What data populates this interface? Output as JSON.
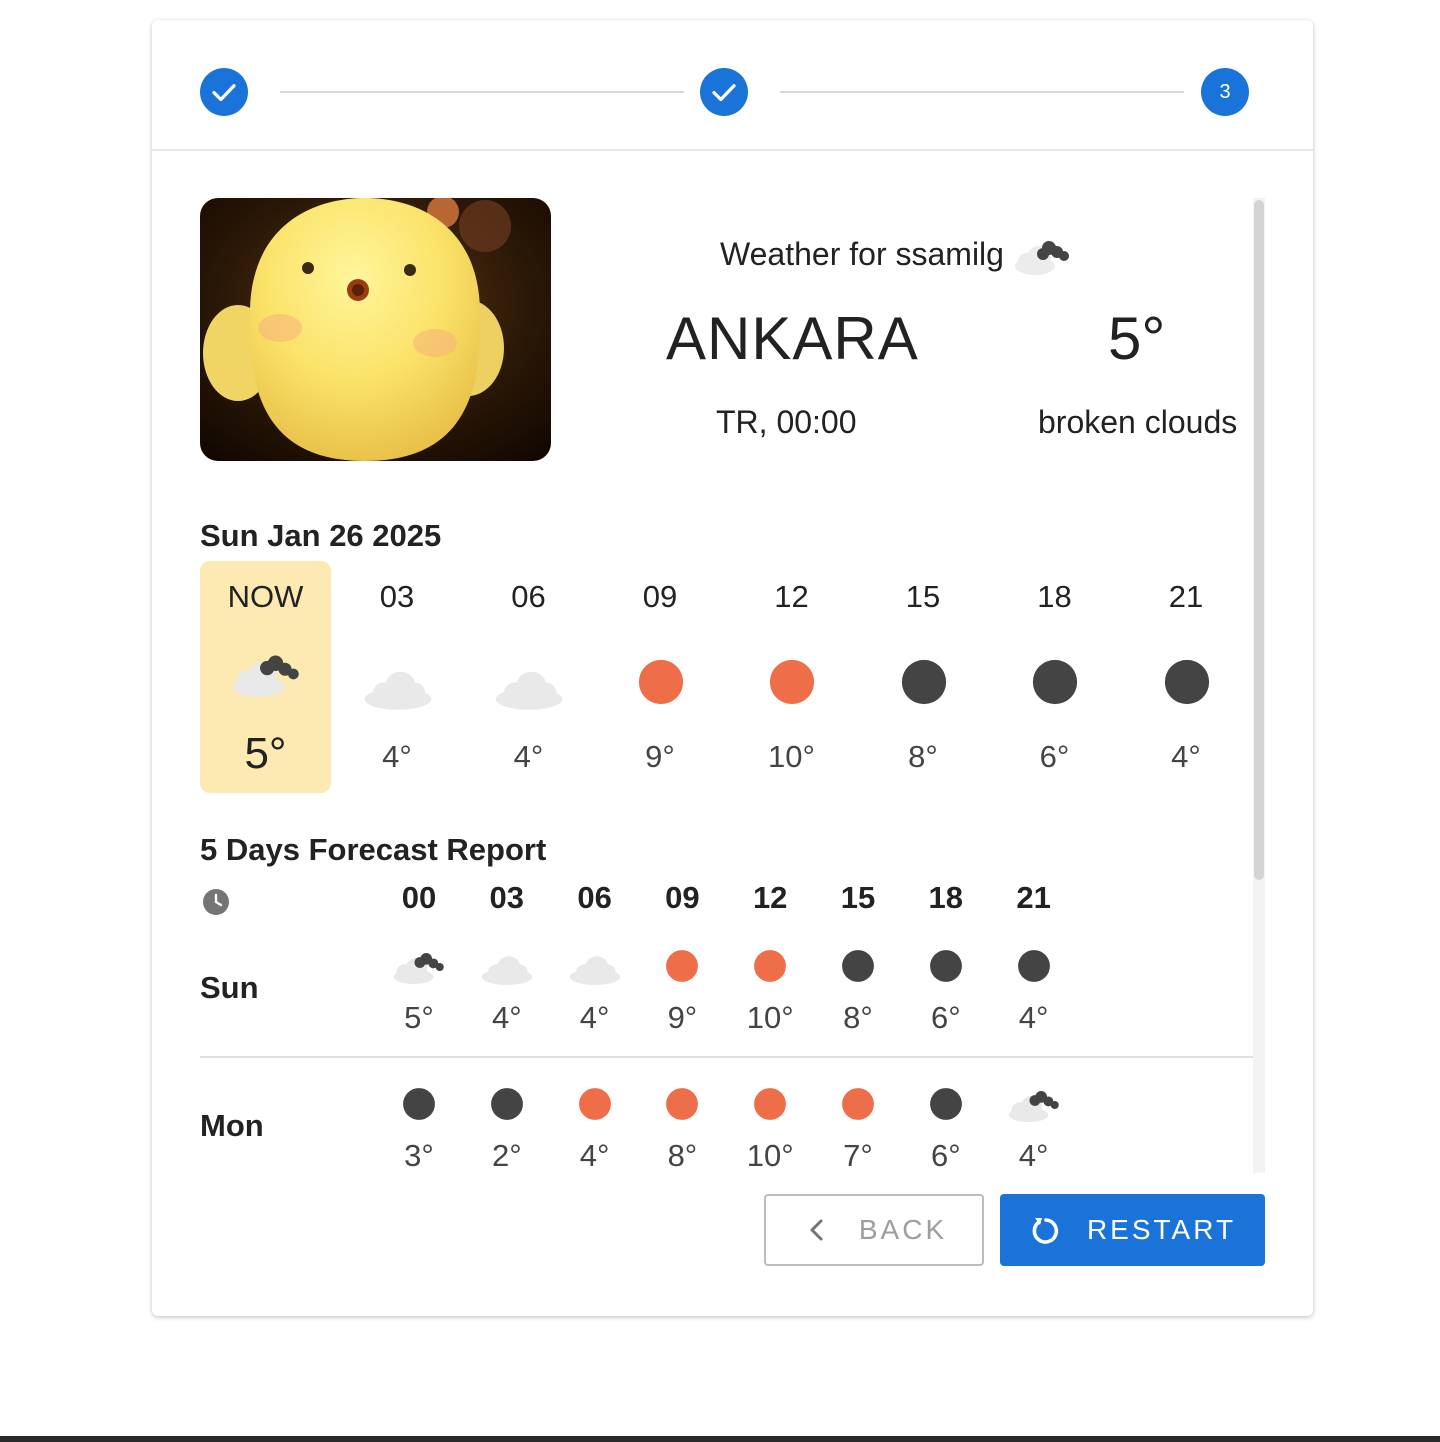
{
  "stepper": {
    "steps": [
      {
        "state": "completed",
        "icon": "check-icon"
      },
      {
        "state": "completed",
        "icon": "check-icon"
      },
      {
        "state": "active",
        "number": "3"
      }
    ],
    "accent": "#1a73d9"
  },
  "header": {
    "weather_for": "Weather for ssamilg",
    "header_icon": "broken-clouds-icon",
    "city": "ANKARA",
    "country_time": "TR, 00:00",
    "temperature": "5°",
    "description": "broken clouds"
  },
  "today": {
    "date": "Sun Jan 26 2025",
    "hours": [
      {
        "label": "NOW",
        "icon": "broken-clouds",
        "temp": "5°"
      },
      {
        "label": "03",
        "icon": "cloud",
        "temp": "4°"
      },
      {
        "label": "06",
        "icon": "cloud",
        "temp": "4°"
      },
      {
        "label": "09",
        "icon": "sun",
        "temp": "9°"
      },
      {
        "label": "12",
        "icon": "sun",
        "temp": "10°"
      },
      {
        "label": "15",
        "icon": "moon",
        "temp": "8°"
      },
      {
        "label": "18",
        "icon": "moon",
        "temp": "6°"
      },
      {
        "label": "21",
        "icon": "moon",
        "temp": "4°"
      }
    ]
  },
  "forecast": {
    "title": "5 Days Forecast Report",
    "clock_icon": "clock-icon",
    "hours": [
      "00",
      "03",
      "06",
      "09",
      "12",
      "15",
      "18",
      "21"
    ],
    "days": [
      {
        "day": "Sun",
        "cells": [
          {
            "icon": "broken-clouds",
            "temp": "5°"
          },
          {
            "icon": "cloud",
            "temp": "4°"
          },
          {
            "icon": "cloud",
            "temp": "4°"
          },
          {
            "icon": "sun",
            "temp": "9°"
          },
          {
            "icon": "sun",
            "temp": "10°"
          },
          {
            "icon": "moon",
            "temp": "8°"
          },
          {
            "icon": "moon",
            "temp": "6°"
          },
          {
            "icon": "moon",
            "temp": "4°"
          }
        ]
      },
      {
        "day": "Mon",
        "cells": [
          {
            "icon": "moon",
            "temp": "3°"
          },
          {
            "icon": "moon",
            "temp": "2°"
          },
          {
            "icon": "sun",
            "temp": "4°"
          },
          {
            "icon": "sun",
            "temp": "8°"
          },
          {
            "icon": "sun",
            "temp": "10°"
          },
          {
            "icon": "sun",
            "temp": "7°"
          },
          {
            "icon": "moon",
            "temp": "6°"
          },
          {
            "icon": "broken-clouds",
            "temp": "4°"
          }
        ]
      }
    ]
  },
  "buttons": {
    "back_label": "BACK",
    "restart_label": "RESTART"
  },
  "colors": {
    "sun": "#ee6e4a",
    "moon": "#444444",
    "cloud": "#e9e9e9",
    "now_highlight": "#fdeab3"
  }
}
